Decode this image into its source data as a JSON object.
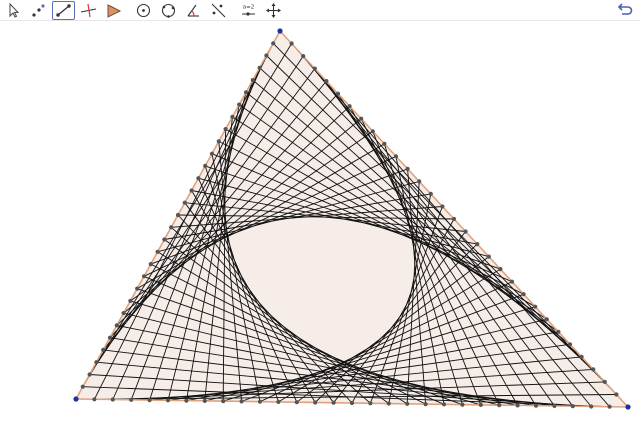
{
  "app": {
    "accent_color": "#5a6fb8",
    "selected_tool": "segment-tool"
  },
  "toolbar": {
    "tools": [
      {
        "id": "move-tool",
        "icon": "pointer-arrow-icon"
      },
      {
        "id": "point-tool",
        "icon": "points-icon"
      },
      {
        "id": "segment-tool",
        "icon": "segment-icon"
      },
      {
        "id": "perpendicular-tool",
        "icon": "perpendicular-line-icon"
      },
      {
        "id": "polygon-tool",
        "icon": "polygon-icon"
      },
      {
        "id": "circle-tool",
        "icon": "circle-center-point-icon"
      },
      {
        "id": "circle-three-points-tool",
        "icon": "circle-three-points-icon"
      },
      {
        "id": "angle-tool",
        "icon": "angle-icon"
      },
      {
        "id": "reflect-tool",
        "icon": "reflect-line-icon"
      },
      {
        "id": "slider-tool",
        "icon": "slider-icon"
      },
      {
        "id": "move-view-tool",
        "icon": "move-graphics-view-icon"
      }
    ],
    "slider_label": "a=2",
    "undo_icon": "undo-arrow-icon"
  },
  "drawing": {
    "triangle_fill": "#f6ece8",
    "triangle_edge_color": "#e0a27c",
    "vertex_color": "#1f2fa8",
    "division_point_color": "#555555",
    "string_line_color": "#111111",
    "divisions_per_side": 30
  }
}
